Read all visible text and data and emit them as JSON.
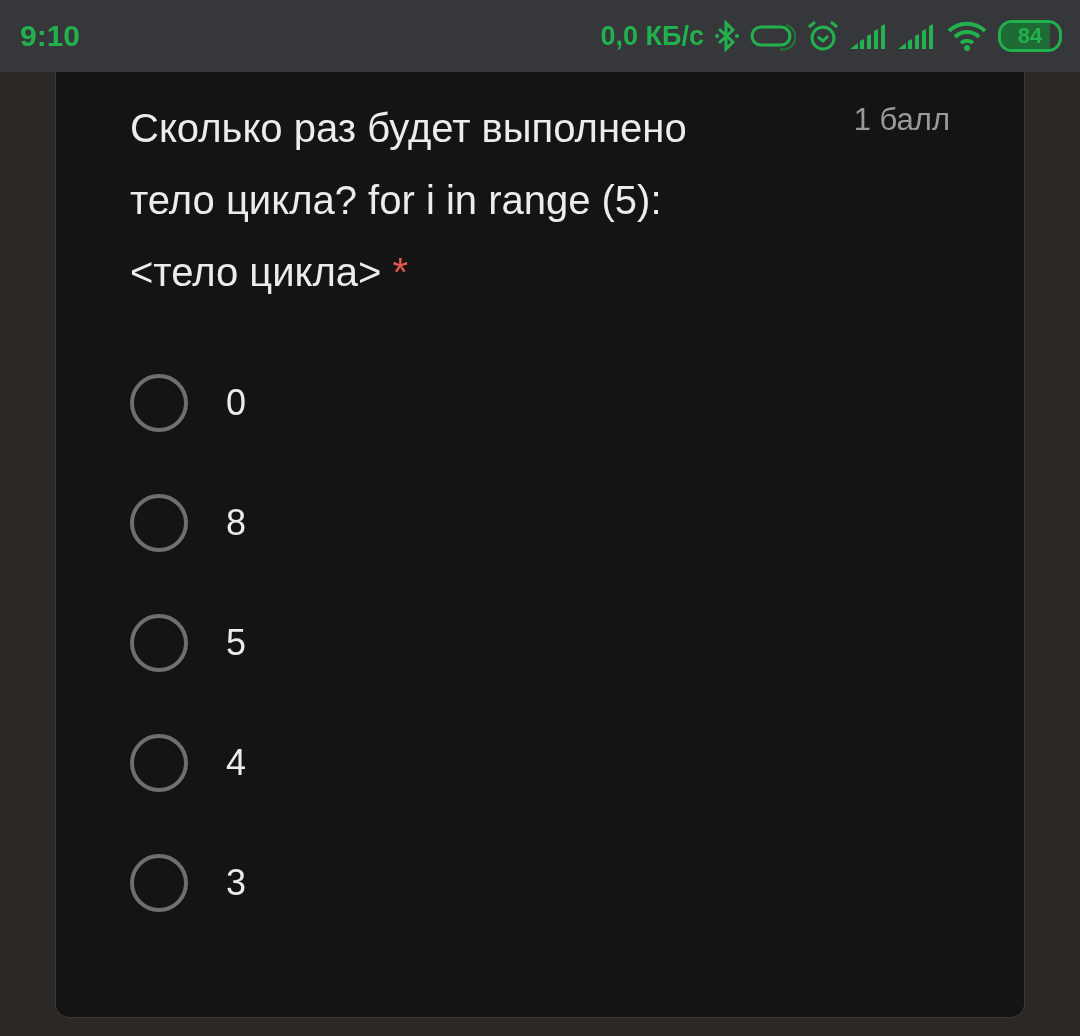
{
  "status_bar": {
    "time": "9:10",
    "speed": "0,0 КБ/с",
    "battery": "84"
  },
  "question": {
    "text": "Сколько раз будет выполнено тело цикла? for i in range (5):<тело цикла>",
    "required_mark": "*",
    "points": "1 балл"
  },
  "options": [
    {
      "label": "0",
      "selected": false
    },
    {
      "label": "8",
      "selected": false
    },
    {
      "label": "5",
      "selected": false
    },
    {
      "label": "4",
      "selected": false
    },
    {
      "label": "3",
      "selected": false
    }
  ]
}
